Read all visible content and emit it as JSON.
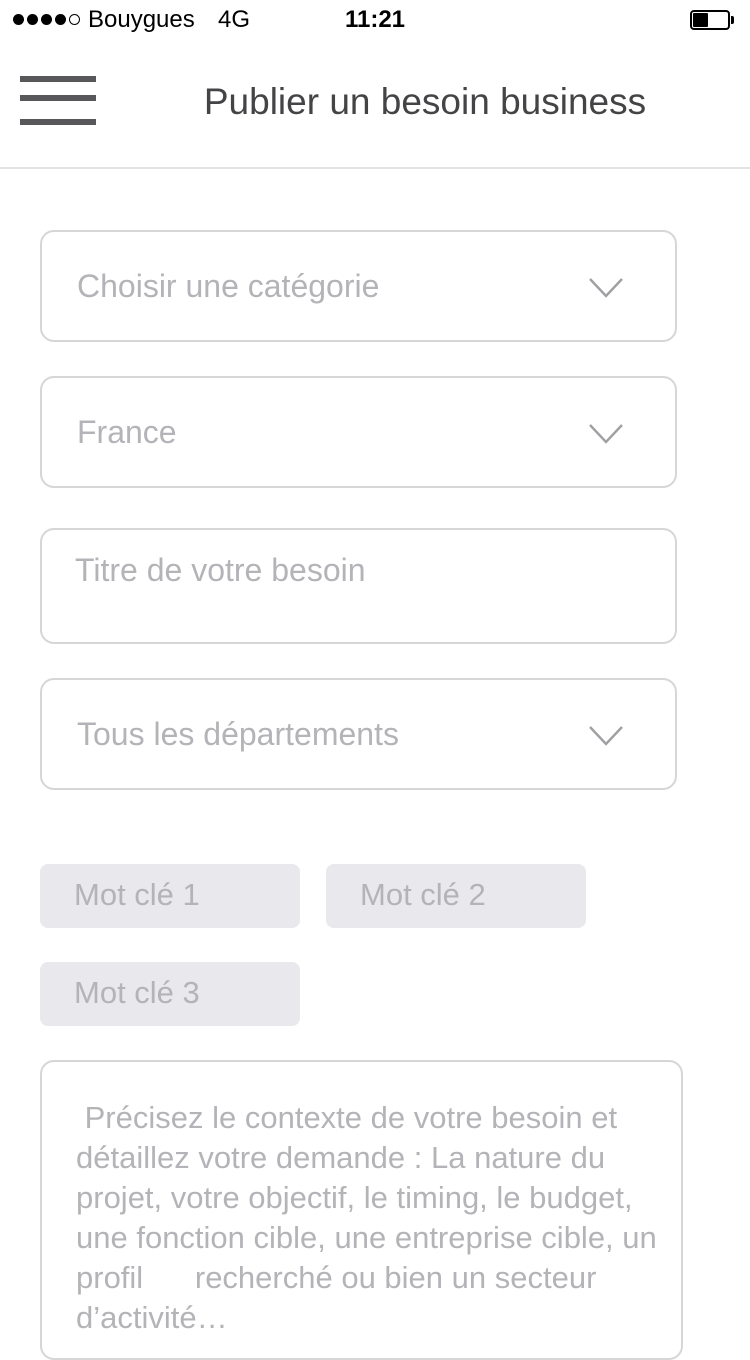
{
  "status_bar": {
    "carrier": "Bouygues",
    "network": "4G",
    "time": "11:21",
    "signal_bars_filled": 4,
    "signal_bars_total": 5,
    "battery_level": 0.45
  },
  "header": {
    "title": "Publier un besoin business",
    "menu_icon": "hamburger-menu-icon"
  },
  "form": {
    "category": {
      "placeholder": "Choisir une catégorie",
      "icon": "chevron-down-icon"
    },
    "country": {
      "value": "France",
      "icon": "chevron-down-icon"
    },
    "title": {
      "placeholder": "Titre de votre besoin"
    },
    "department": {
      "placeholder": "Tous les départements",
      "icon": "chevron-down-icon"
    },
    "keywords": [
      {
        "placeholder": "Mot clé 1"
      },
      {
        "placeholder": "Mot clé 2"
      },
      {
        "placeholder": "Mot clé 3"
      }
    ],
    "description": {
      "placeholder": " Précisez le contexte de votre besoin et détaillez votre demande : La nature du projet, votre objectif, le timing, le budget, une fonction cible, une entreprise cible, un profil      recherché ou bien un secteur d’activité…"
    }
  },
  "colors": {
    "border": "#d6d6d9",
    "placeholder_text": "#b4b4b8",
    "chip_background": "#e8e8ed",
    "title_text": "#444446",
    "menu_icon": "#58585a"
  }
}
